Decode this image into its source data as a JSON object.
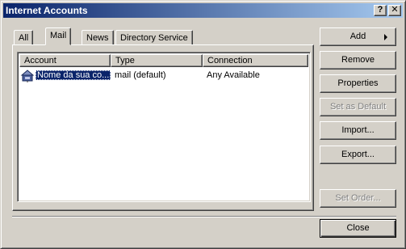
{
  "window": {
    "title": "Internet Accounts",
    "help_glyph": "?",
    "close_glyph": "✕"
  },
  "tabs": [
    {
      "label": "All",
      "active": false
    },
    {
      "label": "Mail",
      "active": true
    },
    {
      "label": "News",
      "active": false
    },
    {
      "label": "Directory Service",
      "active": false
    }
  ],
  "list": {
    "columns": [
      "Account",
      "Type",
      "Connection"
    ],
    "rows": [
      {
        "account": "Nome da sua co...",
        "type": "mail (default)",
        "connection": "Any Available",
        "selected": true,
        "icon": "mail-account-icon"
      }
    ]
  },
  "buttons": {
    "add": "Add",
    "remove": "Remove",
    "properties": "Properties",
    "set_as_default": "Set as Default",
    "import": "Import...",
    "export": "Export...",
    "set_order": "Set Order...",
    "close": "Close"
  },
  "colors": {
    "face": "#d4d0c8",
    "title_start": "#0a246a",
    "title_end": "#a6caf0",
    "selection": "#0a246a"
  }
}
